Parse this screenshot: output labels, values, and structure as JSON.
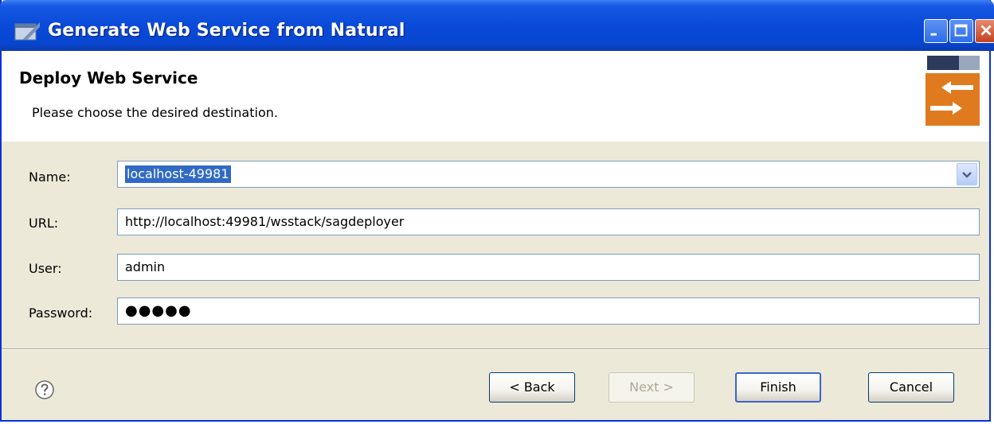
{
  "window": {
    "title": "Generate Web Service from Natural"
  },
  "header": {
    "title": "Deploy Web Service",
    "description": "Please choose the desired destination."
  },
  "form": {
    "name": {
      "label": "Name:",
      "value": "localhost-49981"
    },
    "url": {
      "label": "URL:",
      "value": "http://localhost:49981/wsstack/sagdeployer"
    },
    "user": {
      "label": "User:",
      "value": "admin"
    },
    "password": {
      "label": "Password:",
      "value": "●●●●●"
    }
  },
  "buttons": {
    "back": "< Back",
    "next": "Next >",
    "finish": "Finish",
    "cancel": "Cancel"
  },
  "icons": {
    "title": "eclipse-window-icon",
    "help": "help-icon",
    "wizard": "web-service-exchange-icon"
  },
  "colors": {
    "titlebar": "#0a4ad8",
    "selection": "#316ac5",
    "wizard_orange": "#e07a1f"
  }
}
